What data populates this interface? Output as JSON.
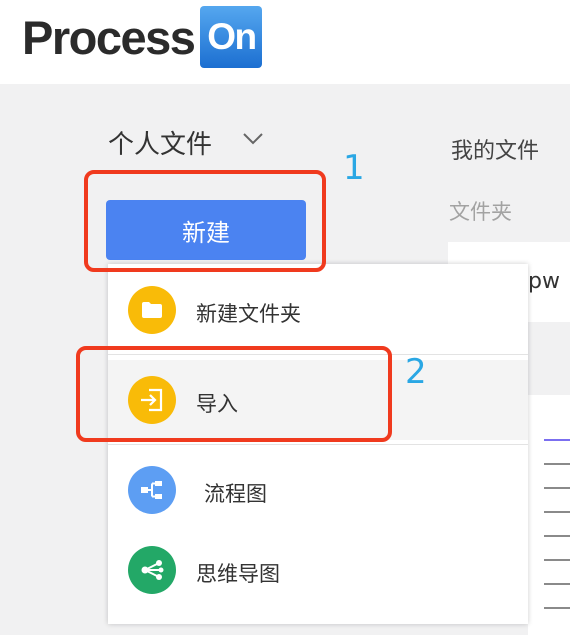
{
  "logo": {
    "word": "Process",
    "box": "On"
  },
  "sidebar": {
    "workspace_label": "个人文件",
    "new_button_label": "新建"
  },
  "right_panel": {
    "title": "我的文件",
    "subtitle": "文件夹",
    "card_text": "pw"
  },
  "menu": {
    "items": [
      {
        "label": "新建文件夹",
        "icon": "folder-icon",
        "color": "#f9bb08"
      },
      {
        "label": "导入",
        "icon": "import-icon",
        "color": "#f9bb08"
      },
      {
        "label": "流程图",
        "icon": "flowchart-icon",
        "color": "#5d9ef3"
      },
      {
        "label": "思维导图",
        "icon": "mindmap-icon",
        "color": "#23a867"
      }
    ]
  },
  "annotations": {
    "first": "1",
    "second": "2"
  },
  "colors": {
    "accent": "#4b83f1",
    "annotation_box": "#f03a1e",
    "annotation_number": "#2aa7e4"
  }
}
